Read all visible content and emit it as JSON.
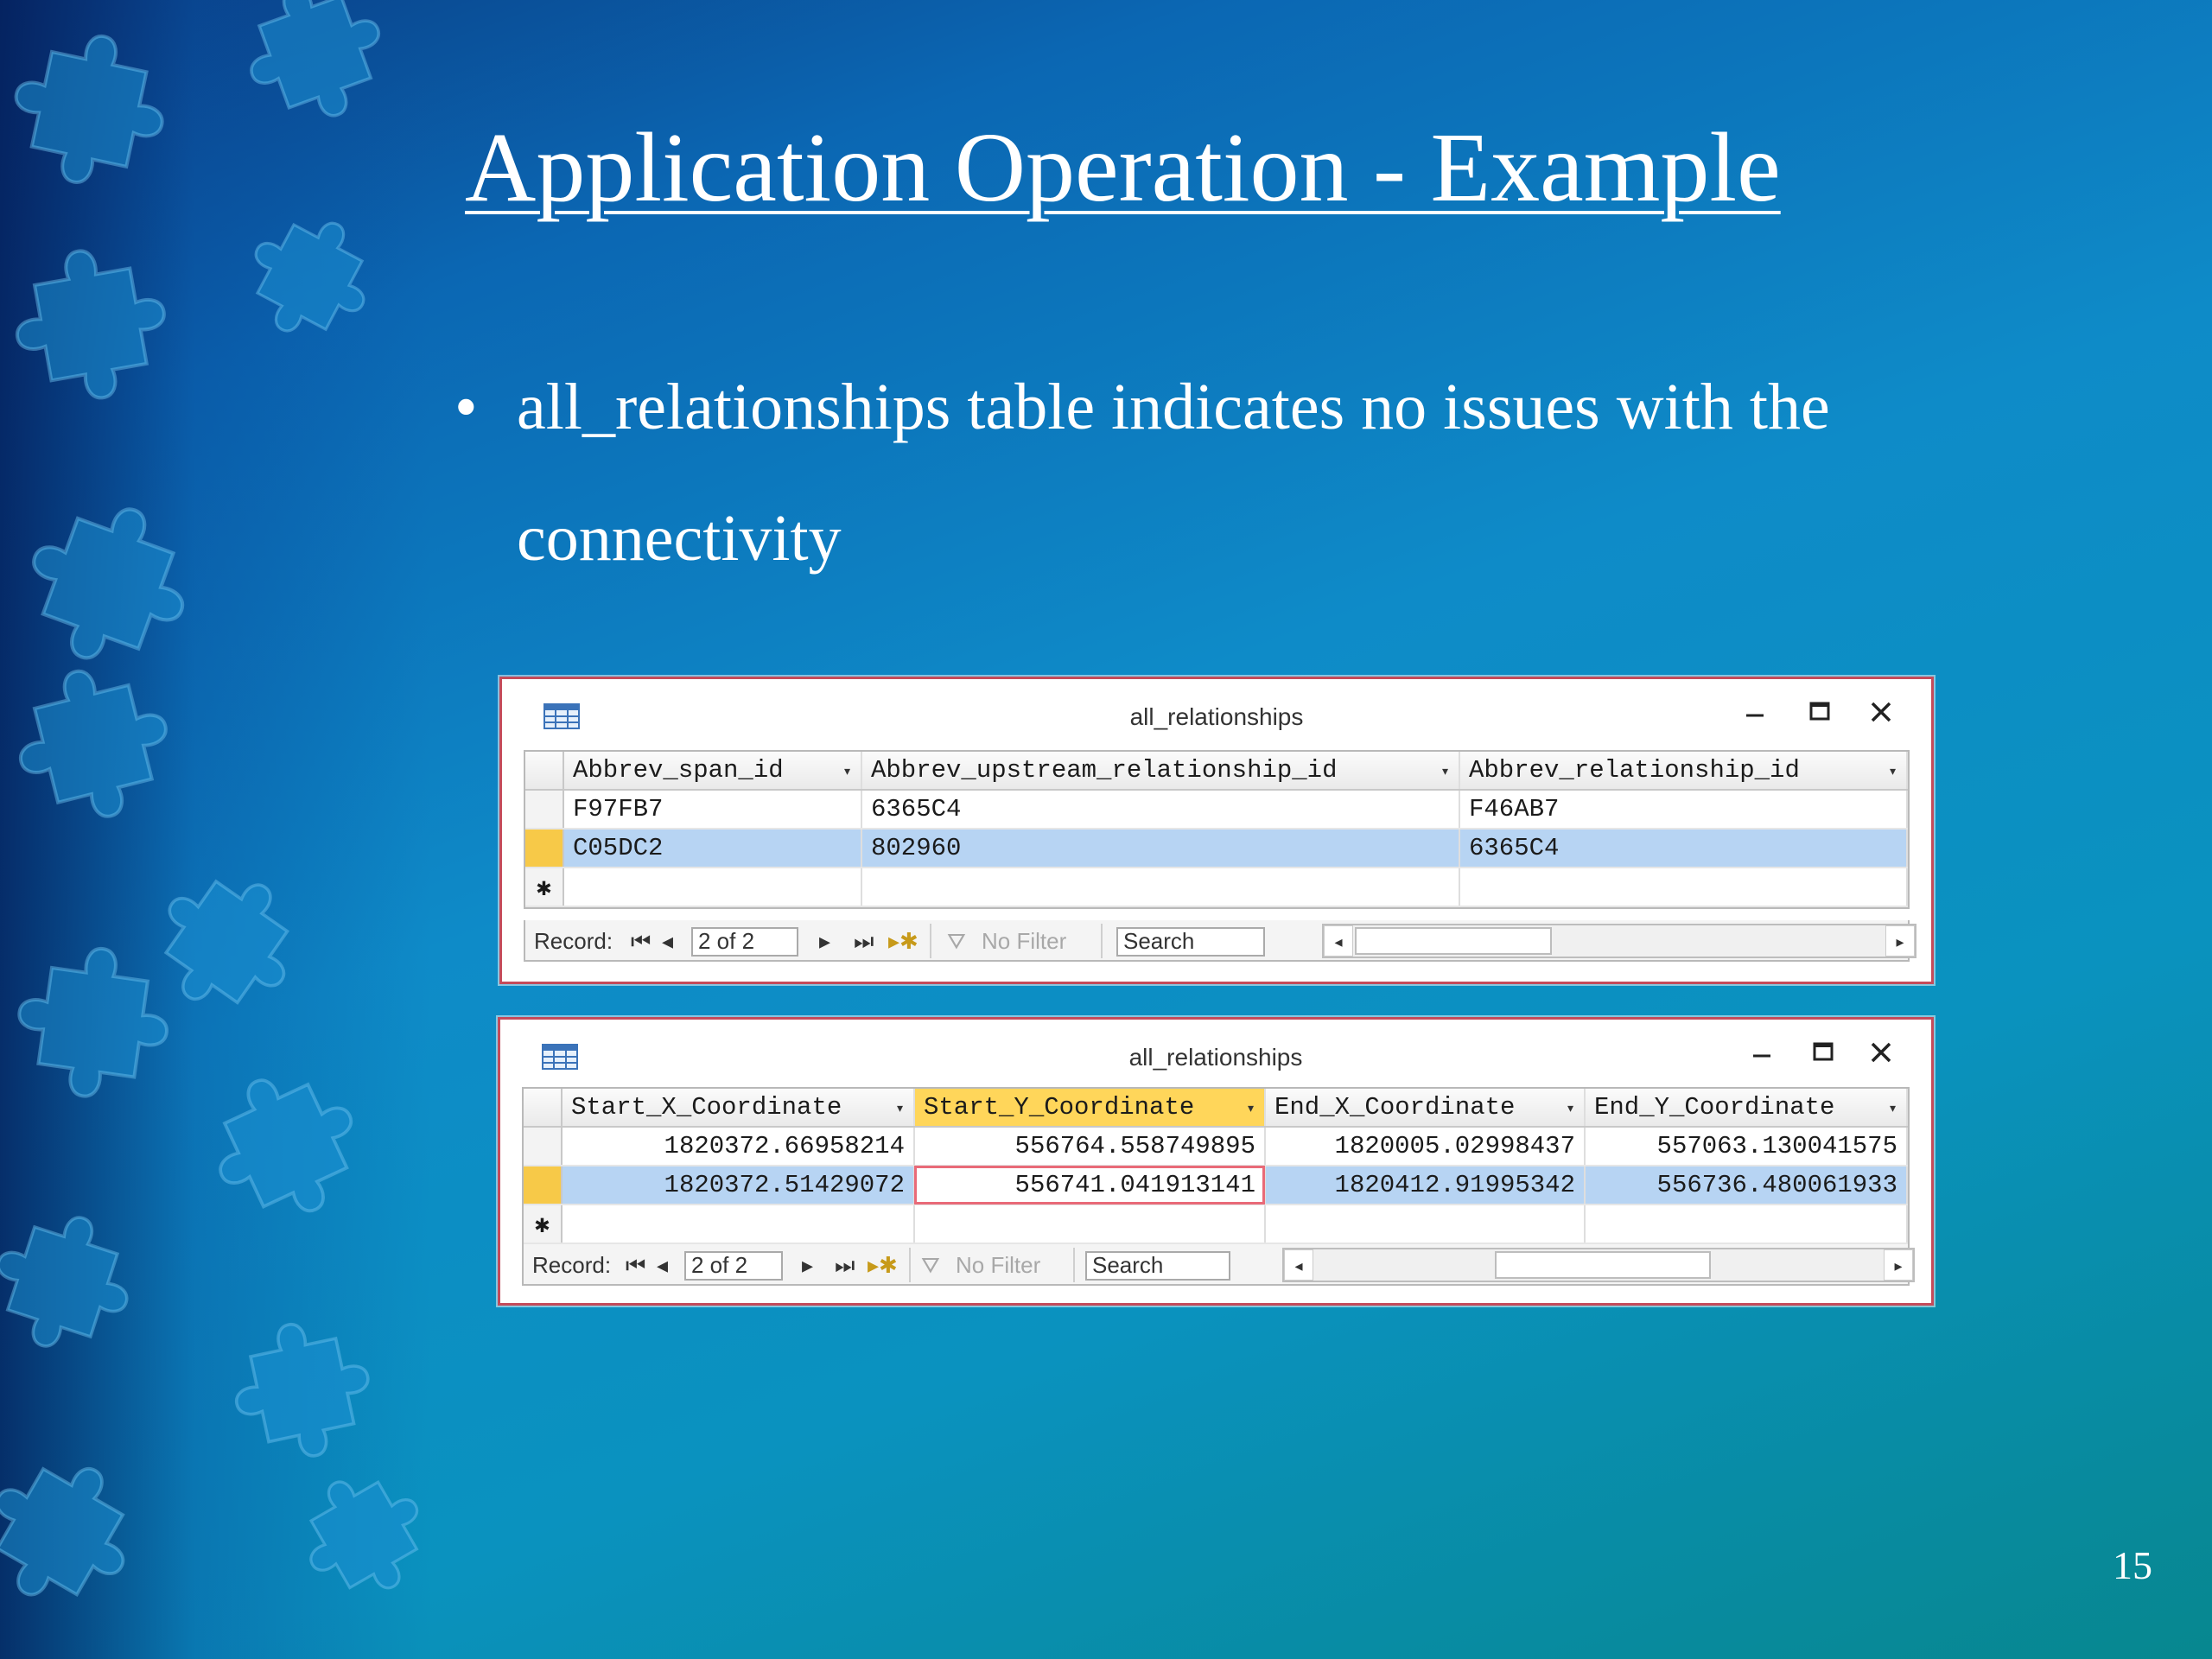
{
  "slide": {
    "title": "Application Operation - Example",
    "bullet_glyph": "•",
    "bullet_text": "all_relationships table indicates no issues with the connectivity",
    "number": "15"
  },
  "icons": {
    "table_icon": "table-icon",
    "min": "minimize-icon",
    "max": "maximize-icon",
    "close": "close-icon"
  },
  "windows": [
    {
      "title": "all_relationships",
      "columns": [
        "Abbrev_span_id",
        "Abbrev_upstream_relationship_id",
        "Abbrev_relationship_id"
      ],
      "rows": [
        [
          "F97FB7",
          "6365C4",
          "F46AB7"
        ],
        [
          "C05DC2",
          "802960",
          "6365C4"
        ]
      ],
      "nav": {
        "record_label": "Record:",
        "record_value": "2 of 2",
        "filter_label": "No Filter",
        "search_placeholder": "Search"
      }
    },
    {
      "title": "all_relationships",
      "columns": [
        "Start_X_Coordinate",
        "Start_Y_Coordinate",
        "End_X_Coordinate",
        "End_Y_Coordinate"
      ],
      "rows": [
        [
          "1820372.66958214",
          "556764.558749895",
          "1820005.02998437",
          "557063.130041575"
        ],
        [
          "1820372.51429072",
          "556741.041913141",
          "1820412.91995342",
          "556736.480061933"
        ]
      ],
      "nav": {
        "record_label": "Record:",
        "record_value": "2 of 2",
        "filter_label": "No Filter",
        "search_placeholder": "Search"
      }
    }
  ],
  "colors": {
    "selected_row": "#b7d4f3",
    "selector_marker": "#f7c948",
    "highlight_header": "#ffd65a",
    "window_border": "#c44b5a"
  }
}
